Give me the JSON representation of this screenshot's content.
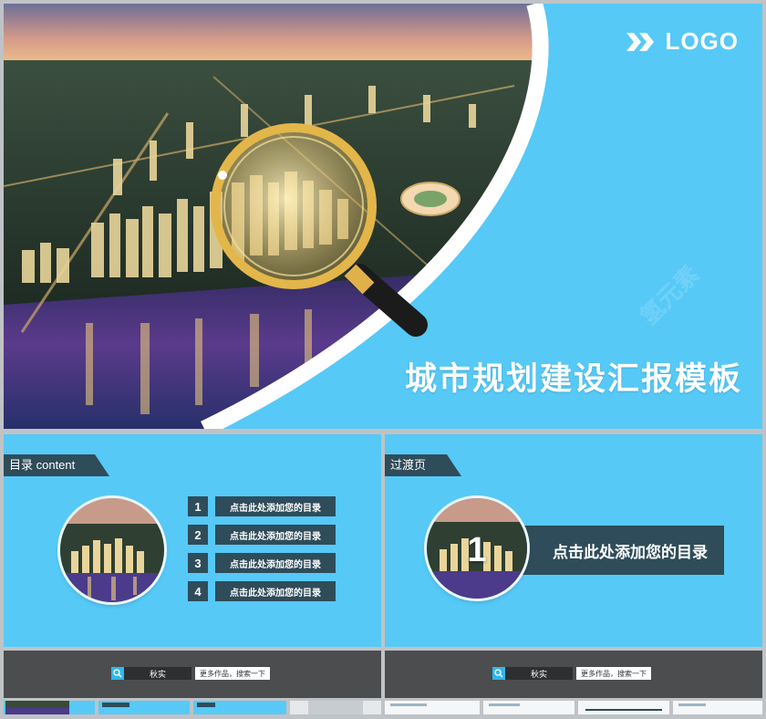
{
  "hero": {
    "logo": "LOGO",
    "title": "城市规划建设汇报模板"
  },
  "toc_slide": {
    "tag": "目录 content",
    "items": [
      {
        "num": "1",
        "label": "点击此处添加您的目录"
      },
      {
        "num": "2",
        "label": "点击此处添加您的目录"
      },
      {
        "num": "3",
        "label": "点击此处添加您的目录"
      },
      {
        "num": "4",
        "label": "点击此处添加您的目录"
      }
    ]
  },
  "transition_slide": {
    "tag": "过渡页",
    "num": "1",
    "label": "点击此处添加您的目录"
  },
  "search_bars": [
    {
      "query": "秋实",
      "hint": "更多作品，搜索一下"
    },
    {
      "query": "秋实",
      "hint": "更多作品，搜索一下"
    }
  ],
  "watermark": "氢元素",
  "colors": {
    "accent": "#56c9f7",
    "dark": "#2f4c5a",
    "bar": "#4b4d4f"
  }
}
